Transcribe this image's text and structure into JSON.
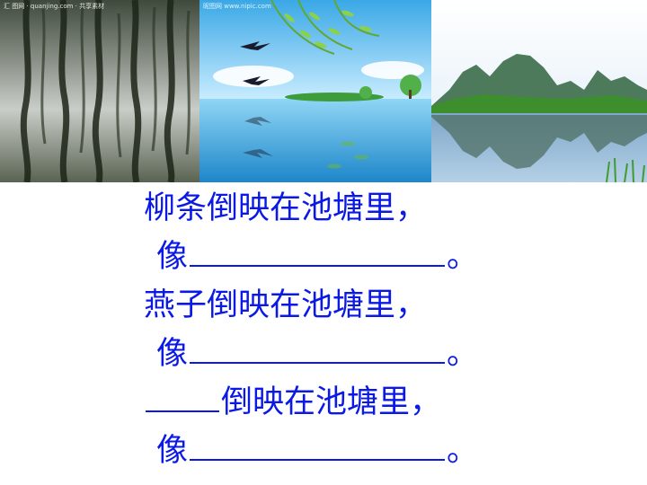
{
  "photos": {
    "willow_watermark": "汇 图网 · quanjing.com · 共享素材",
    "swallow_watermark": "昵图网 www.nipic.com"
  },
  "poem": {
    "line1": "柳条倒映在池塘里，",
    "line2_prefix": "像",
    "line2_suffix": "。",
    "line3": "燕子倒映在池塘里，",
    "line4_prefix": "像",
    "line4_suffix": "。",
    "line5_text": "倒映在池塘里，",
    "line6_prefix": "像",
    "line6_suffix": "。"
  },
  "colors": {
    "text": "#0a19e6",
    "background": "#ffffff"
  }
}
